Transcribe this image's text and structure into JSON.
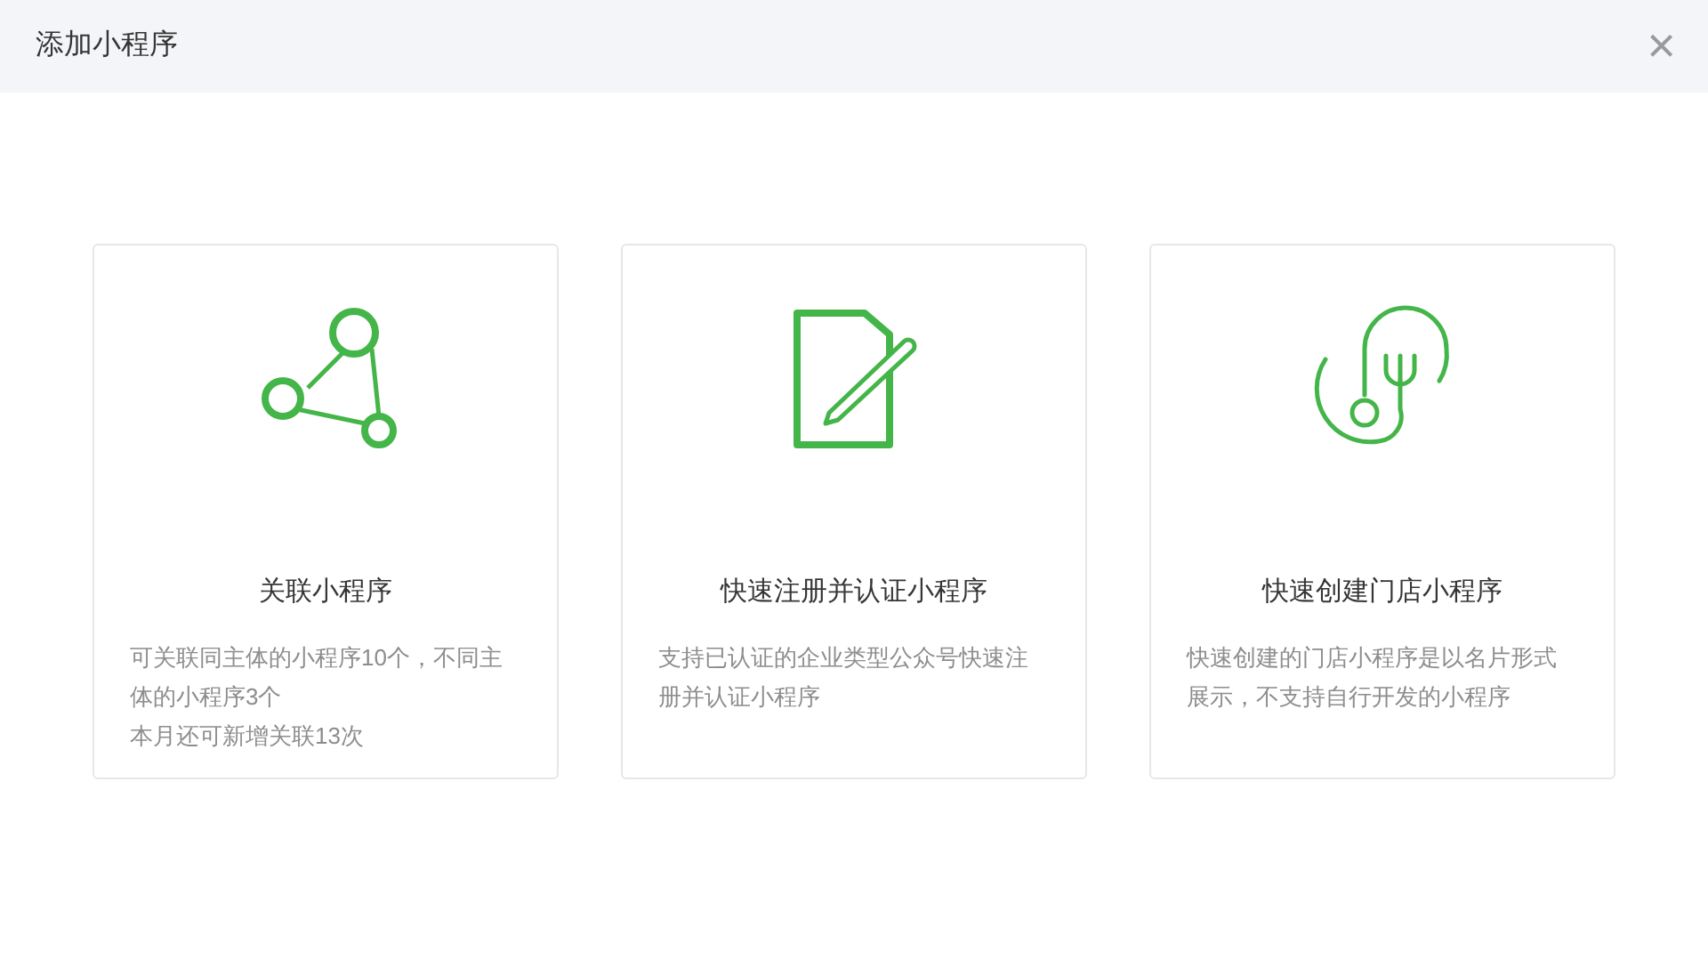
{
  "dialog": {
    "title": "添加小程序",
    "close": "×"
  },
  "cards": [
    {
      "kind": "link",
      "title": "关联小程序",
      "description": [
        "可关联同主体的小程序10个，不同主体的小程序3个",
        "本月还可新增关联13次"
      ]
    },
    {
      "kind": "register",
      "title": "快速注册并认证小程序",
      "description": [
        "支持已认证的企业类型公众号快速注册并认证小程序"
      ]
    },
    {
      "kind": "store",
      "title": "快速创建门店小程序",
      "description": [
        "快速创建的门店小程序是以名片形式展示，不支持自行开发的小程序"
      ]
    }
  ]
}
